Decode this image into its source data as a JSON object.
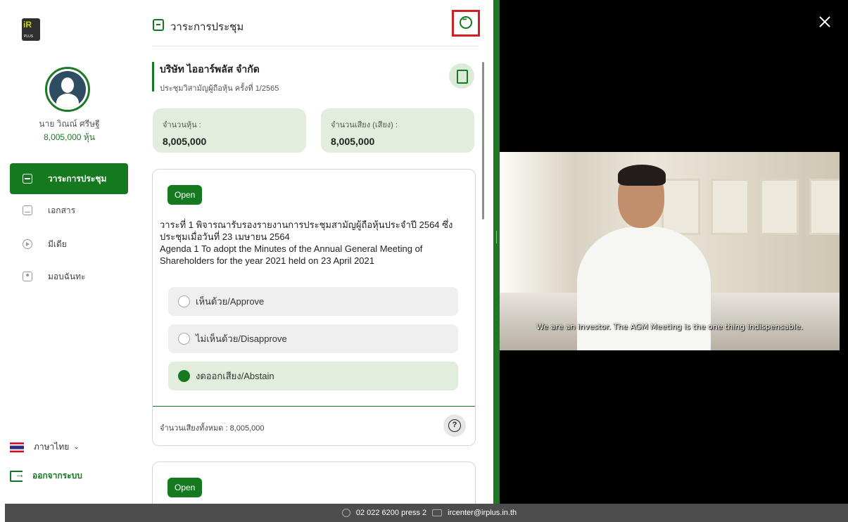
{
  "sidebar": {
    "user_name": "นาย วิณณ์ ศรีษฐี",
    "user_shares": "8,005,000 หุ้น",
    "nav": [
      {
        "label": "วาระการประชุม",
        "active": true,
        "icon": "agenda-icon"
      },
      {
        "label": "เอกสาร",
        "active": false,
        "icon": "folder-icon"
      },
      {
        "label": "มีเดีย",
        "active": false,
        "icon": "play-icon"
      },
      {
        "label": "มอบฉันทะ",
        "active": false,
        "icon": "proxy-icon"
      }
    ],
    "language": "ภาษาไทย",
    "logout": "ออกจากระบบ"
  },
  "main": {
    "title": "วาระการประชุม",
    "company_name": "บริษัท ไออาร์พลัส จำกัด",
    "meeting_subtitle": "ประชุมวิสามัญผู้ถือหุ้น ครั้งที่ 1/2565",
    "shares_label": "จำนวนหุ้น :",
    "shares_value": "8,005,000",
    "votes_label": "จำนวนเสียง (เสียง) :",
    "votes_value": "8,005,000",
    "agenda": {
      "status": "Open",
      "title_th": "วาระที่ 1 พิจารณารับรองรายงานการประชุมสามัญผู้ถือหุ้นประจำปี 2564 ซึ่งประชุมเมื่อวันที่ 23 เมษายน 2564",
      "title_en": "Agenda 1 To adopt the Minutes of the Annual General Meeting of Shareholders for the year 2021 held on 23 April 2021",
      "options": [
        {
          "label": "เห็นด้วย/Approve",
          "selected": false
        },
        {
          "label": "ไม่เห็นด้วย/Disapprove",
          "selected": false
        },
        {
          "label": "งดออกเสียง/Abstain",
          "selected": true
        }
      ],
      "total_votes": "จำนวนเสียงทั้งหมด : 8,005,000",
      "help_glyph": "?"
    },
    "agenda2_status": "Open"
  },
  "video": {
    "subtitle": "We are an investor. The AGM Meeting is the one thing indispensable."
  },
  "footer": {
    "phone": "02 022 6200 press 2",
    "email": "ircenter@irplus.in.th"
  },
  "colors": {
    "brand_green": "#157a1f",
    "light_green": "#e1eedd",
    "highlight_red": "#d02020"
  }
}
